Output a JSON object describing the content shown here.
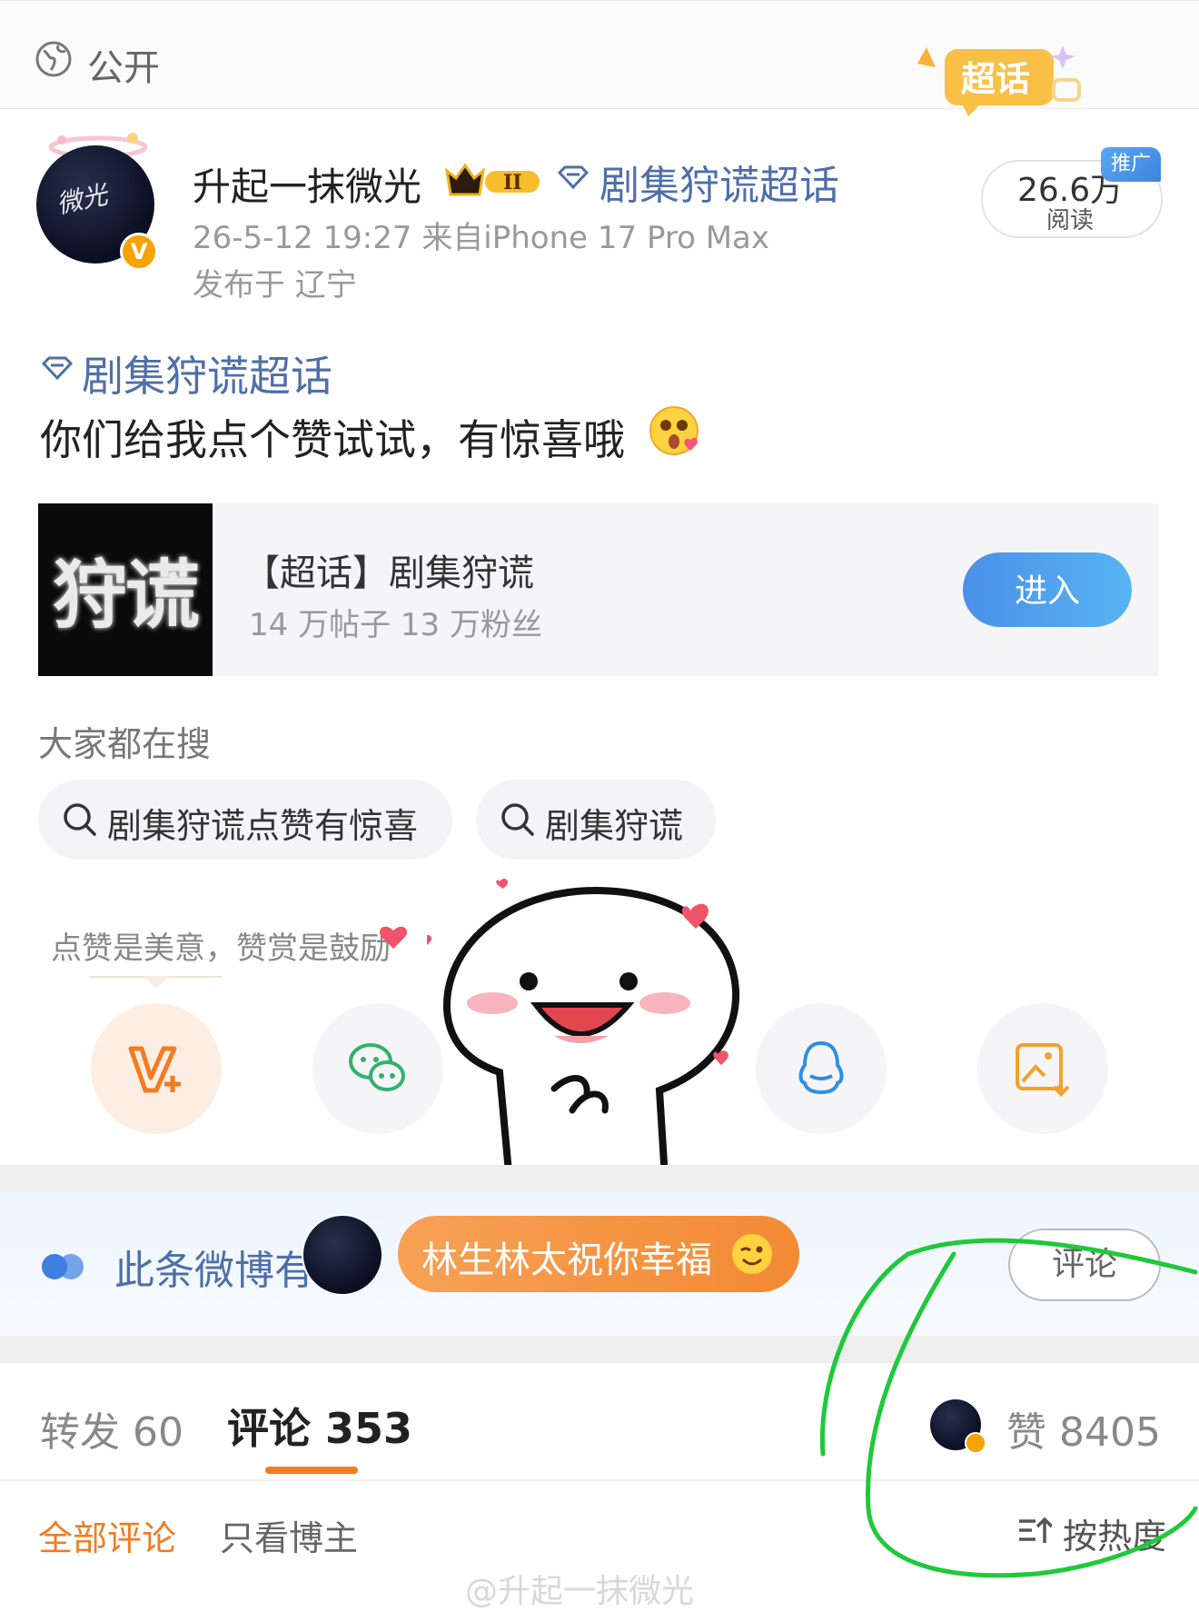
{
  "header": {
    "visibility": "公开",
    "badge": "超话"
  },
  "post": {
    "author": "升起一抹微光",
    "level_badge": "II",
    "topic": "剧集狩谎超话",
    "time": "26-5-12 19:27",
    "source": "来自iPhone 17 Pro Max",
    "location": "发布于 辽宁",
    "reads": "26.6万",
    "reads_label": "阅读",
    "promo": "推广",
    "topic_link": "剧集狩谎超话",
    "text": "你们给我点个赞试试，有惊喜哦"
  },
  "topic_card": {
    "thumb": "狩谎",
    "title": "【超话】剧集狩谎",
    "subtitle": "14 万帖子 13 万粉丝",
    "button": "进入"
  },
  "search": {
    "heading": "大家都在搜",
    "chips": [
      "剧集狩谎点赞有惊喜",
      "剧集狩谎"
    ]
  },
  "reward": {
    "hint": "点赞是美意，赞赏是鼓励"
  },
  "share": {
    "icons": [
      "reward-v-icon",
      "wechat-icon",
      "qq-icon",
      "save-image-icon"
    ]
  },
  "banner": {
    "text": "此条微博有10",
    "pill": "林生林太祝你幸福",
    "comment_button": "评论"
  },
  "tabs": {
    "repost": "转发 60",
    "comments": "评论 353",
    "likes": "赞 8405"
  },
  "filters": {
    "all": "全部评论",
    "owner": "只看博主",
    "sort": "按热度"
  },
  "watermark": "@升起一抹微光",
  "colors": {
    "accent_orange": "#f37b20",
    "link_blue": "#4f6fa8",
    "enter_blue": "#4a90e8",
    "annotation_green": "#1ec93a"
  }
}
